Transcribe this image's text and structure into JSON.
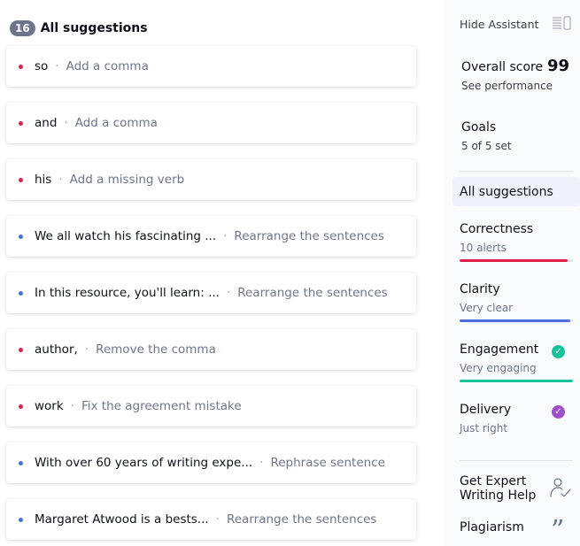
{
  "suggestions_panel": {
    "count": "16",
    "title": "All suggestions",
    "cards": [
      {
        "word": "so",
        "hint": "Add a comma",
        "kind": "correctness"
      },
      {
        "word": "and",
        "hint": "Add a comma",
        "kind": "correctness"
      },
      {
        "word": "his",
        "hint": "Add a missing verb",
        "kind": "correctness"
      },
      {
        "word": "We all watch his fascinating ...",
        "hint": "Rearrange the sentences",
        "kind": "clarity"
      },
      {
        "word": "In this resource, you'll learn: ...",
        "hint": "Rearrange the sentences",
        "kind": "clarity"
      },
      {
        "word": "author,",
        "hint": "Remove the comma",
        "kind": "correctness"
      },
      {
        "word": "work",
        "hint": "Fix the agreement mistake",
        "kind": "correctness"
      },
      {
        "word": "With over 60 years of writing expe...",
        "hint": "Rephrase sentence",
        "kind": "clarity"
      },
      {
        "word": "Margaret Atwood is a bests...",
        "hint": "Rearrange the sentences",
        "kind": "clarity"
      }
    ]
  },
  "assistant": {
    "hide_label": "Hide Assistant",
    "hide_icon": "sidebar-panel-icon",
    "overall_score_label": "Overall score",
    "overall_score_value": "99",
    "see_performance": "See performance",
    "goals_label": "Goals",
    "goals_sub": "5 of 5 set",
    "all_suggestions": "All suggestions",
    "categories": {
      "correctness": {
        "title": "Correctness",
        "sub": "10 alerts",
        "color": "#e11d48",
        "fill": 0.95
      },
      "clarity": {
        "title": "Clarity",
        "sub": "Very clear",
        "color": "#4a6ee0",
        "fill": 0.98
      },
      "engagement": {
        "title": "Engagement",
        "sub": "Very engaging",
        "color": "#15c39a",
        "fill": 1.0,
        "badge": "check-icon"
      },
      "delivery": {
        "title": "Delivery",
        "sub": "Just right",
        "color": "#9d4fce",
        "badge": "check-icon"
      }
    },
    "expert_help": "Get Expert Writing Help",
    "expert_icon": "expert-person-icon",
    "plagiarism": "Plagiarism",
    "plagiarism_icon": "quote-icon"
  },
  "colors": {
    "correctness": "#e11d48",
    "clarity": "#4a6ee0"
  }
}
